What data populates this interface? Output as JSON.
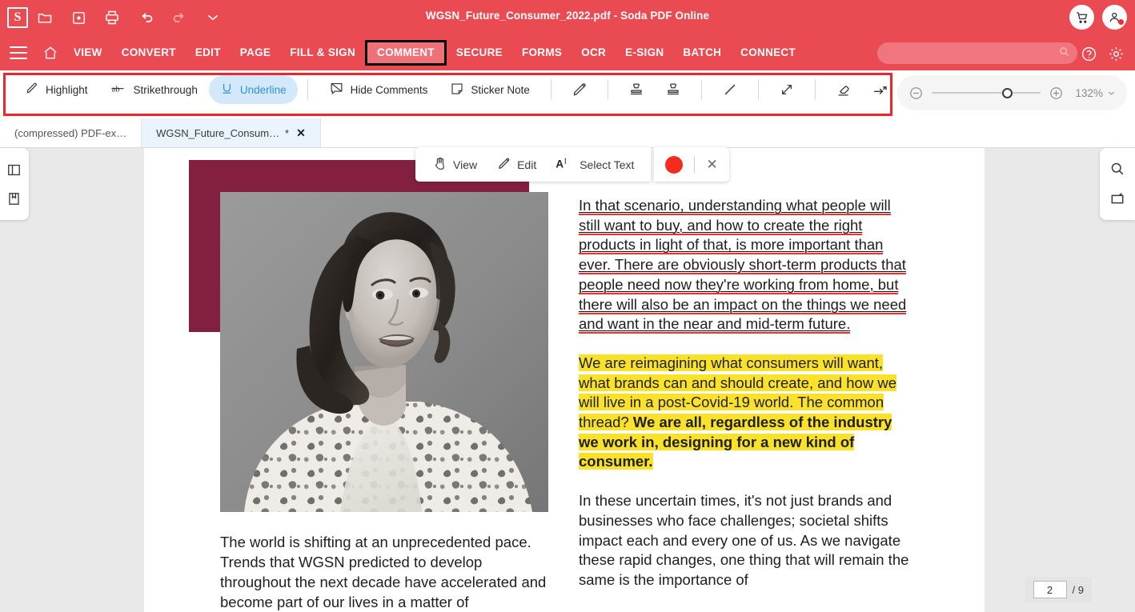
{
  "app": {
    "title": "WGSN_Future_Consumer_2022.pdf - Soda PDF Online",
    "logo_letter": "S"
  },
  "header": {
    "quick_icons": [
      "open-folder-icon",
      "save-icon",
      "print-icon",
      "undo-icon",
      "redo-icon",
      "chevron-down-icon"
    ],
    "cart_icon": "cart-icon",
    "account_icon": "account-icon",
    "help_icon": "help-icon",
    "settings_icon": "gear-icon",
    "search": {
      "value": "",
      "placeholder": ""
    },
    "menu": [
      {
        "label": "VIEW",
        "active": false
      },
      {
        "label": "CONVERT",
        "active": false
      },
      {
        "label": "EDIT",
        "active": false
      },
      {
        "label": "PAGE",
        "active": false
      },
      {
        "label": "FILL & SIGN",
        "active": false
      },
      {
        "label": "COMMENT",
        "active": true
      },
      {
        "label": "SECURE",
        "active": false
      },
      {
        "label": "FORMS",
        "active": false
      },
      {
        "label": "OCR",
        "active": false
      },
      {
        "label": "E-SIGN",
        "active": false
      },
      {
        "label": "BATCH",
        "active": false
      },
      {
        "label": "CONNECT",
        "active": false
      }
    ]
  },
  "toolbar": {
    "highlight_label": "Highlight",
    "strikethrough_label": "Strikethrough",
    "underline_label": "Underline",
    "hide_comments_label": "Hide Comments",
    "sticker_note_label": "Sticker Note",
    "active_tool": "Underline",
    "icon_tools": [
      "pencil-icon",
      "stamp-icon",
      "stamp-alt-icon",
      "line-icon",
      "arrow-icon",
      "eraser-icon",
      "callout-icon"
    ],
    "accent_color": "#f0242b",
    "active_pill_bg": "#d3e9fa",
    "active_pill_fg": "#2e90e0"
  },
  "zoom": {
    "minus_icon": "zoom-out-icon",
    "plus_icon": "zoom-in-icon",
    "value": "132%",
    "chevron": "chevron-down-icon",
    "slider_percent": 65
  },
  "tabs": [
    {
      "label": "(compressed)  PDF-ex…",
      "active": false,
      "modified": false
    },
    {
      "label": "WGSN_Future_Consum…",
      "active": true,
      "modified": true,
      "modified_marker": "*",
      "close": "✕"
    }
  ],
  "left_rail": {
    "icons": [
      "panel-layout-icon",
      "bookmark-icon"
    ]
  },
  "right_rail": {
    "icons": [
      "search-icon",
      "page-thumbnail-icon"
    ]
  },
  "context_toolbar": {
    "view_label": "View",
    "edit_label": "Edit",
    "select_text_label": "Select Text",
    "color_swatch": "#f42c20",
    "close_label": "✕"
  },
  "document": {
    "accent_maroon": "#84203f",
    "highlight_color": "#fbe22a",
    "underline_color": "#ff2a2a",
    "left_column": {
      "paragraph": "The world is shifting at an unprecedented pace. Trends that WGSN predicted to develop throughout the next decade have accelerated and become part of our lives in a matter of"
    },
    "right_column": {
      "underlined_paragraph": "In that scenario, understanding what people will still want to buy, and how to create the right products in light of that, is more important than ever. There are obviously short-term products that people need now they're working from home, but there will also be an impact on the things we need and want in the near and mid-term future.",
      "highlighted_paragraph_plain": "We are reimagining what consumers will want, what brands can and should create, and how we will live in a post-Covid-19 world. The common thread? ",
      "highlighted_paragraph_bold": "We are all, regardless of the industry we work in, designing for a new kind of consumer.",
      "last_paragraph": "In these uncertain times, it's not just brands and businesses who face challenges; societal shifts impact each and every one of us. As we navigate these rapid changes, one thing that will remain the same is the importance of"
    }
  },
  "page_nav": {
    "current": "2",
    "separator": "/ 9",
    "total": "9"
  }
}
